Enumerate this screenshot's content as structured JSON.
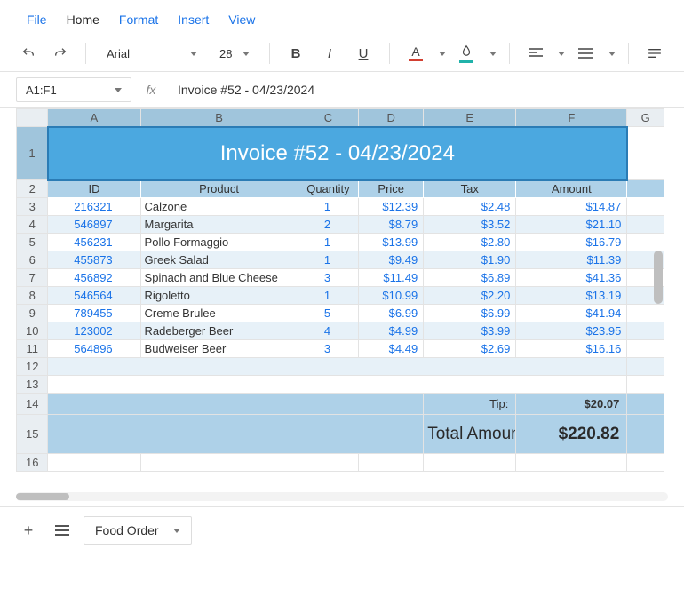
{
  "menu": {
    "items": [
      "File",
      "Home",
      "Format",
      "Insert",
      "View"
    ],
    "active": 1
  },
  "toolbar": {
    "font": "Arial",
    "size": "28",
    "textcolor_bar": "#d23f31",
    "fillcolor_bar": "#20b2aa"
  },
  "formulaBar": {
    "ref": "A1:F1",
    "fx": "fx",
    "value": "Invoice #52 - 04/23/2024"
  },
  "columns": [
    "A",
    "B",
    "C",
    "D",
    "E",
    "F",
    "G"
  ],
  "title": "Invoice #52 - 04/23/2024",
  "headers": [
    "ID",
    "Product",
    "Quantity",
    "Price",
    "Tax",
    "Amount"
  ],
  "rows": [
    {
      "id": "216321",
      "product": "Calzone",
      "qty": "1",
      "price": "$12.39",
      "tax": "$2.48",
      "amount": "$14.87"
    },
    {
      "id": "546897",
      "product": "Margarita",
      "qty": "2",
      "price": "$8.79",
      "tax": "$3.52",
      "amount": "$21.10"
    },
    {
      "id": "456231",
      "product": "Pollo Formaggio",
      "qty": "1",
      "price": "$13.99",
      "tax": "$2.80",
      "amount": "$16.79"
    },
    {
      "id": "455873",
      "product": "Greek Salad",
      "qty": "1",
      "price": "$9.49",
      "tax": "$1.90",
      "amount": "$11.39"
    },
    {
      "id": "456892",
      "product": "Spinach and Blue Cheese",
      "qty": "3",
      "price": "$11.49",
      "tax": "$6.89",
      "amount": "$41.36"
    },
    {
      "id": "546564",
      "product": "Rigoletto",
      "qty": "1",
      "price": "$10.99",
      "tax": "$2.20",
      "amount": "$13.19"
    },
    {
      "id": "789455",
      "product": "Creme Brulee",
      "qty": "5",
      "price": "$6.99",
      "tax": "$6.99",
      "amount": "$41.94"
    },
    {
      "id": "123002",
      "product": "Radeberger Beer",
      "qty": "4",
      "price": "$4.99",
      "tax": "$3.99",
      "amount": "$23.95"
    },
    {
      "id": "564896",
      "product": "Budweiser Beer",
      "qty": "3",
      "price": "$4.49",
      "tax": "$2.69",
      "amount": "$16.16"
    }
  ],
  "tip": {
    "label": "Tip:",
    "value": "$20.07"
  },
  "total": {
    "label": "Total Amount:",
    "value": "$220.82"
  },
  "sheet": {
    "name": "Food Order"
  },
  "chart_data": {
    "type": "table",
    "title": "Invoice #52 - 04/23/2024",
    "columns": [
      "ID",
      "Product",
      "Quantity",
      "Price",
      "Tax",
      "Amount"
    ],
    "rows": [
      [
        "216321",
        "Calzone",
        1,
        12.39,
        2.48,
        14.87
      ],
      [
        "546897",
        "Margarita",
        2,
        8.79,
        3.52,
        21.1
      ],
      [
        "456231",
        "Pollo Formaggio",
        1,
        13.99,
        2.8,
        16.79
      ],
      [
        "455873",
        "Greek Salad",
        1,
        9.49,
        1.9,
        11.39
      ],
      [
        "456892",
        "Spinach and Blue Cheese",
        3,
        11.49,
        6.89,
        41.36
      ],
      [
        "546564",
        "Rigoletto",
        1,
        10.99,
        2.2,
        13.19
      ],
      [
        "789455",
        "Creme Brulee",
        5,
        6.99,
        6.99,
        41.94
      ],
      [
        "123002",
        "Radeberger Beer",
        4,
        4.99,
        3.99,
        23.95
      ],
      [
        "564896",
        "Budweiser Beer",
        3,
        4.49,
        2.69,
        16.16
      ]
    ],
    "tip": 20.07,
    "total": 220.82
  }
}
